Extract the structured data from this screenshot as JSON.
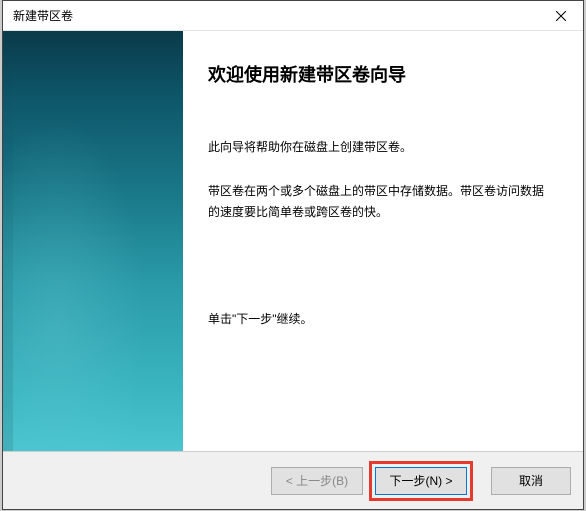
{
  "titlebar": {
    "title": "新建带区卷"
  },
  "main": {
    "heading": "欢迎使用新建带区卷向导",
    "para1": "此向导将帮助你在磁盘上创建带区卷。",
    "para2": "带区卷在两个或多个磁盘上的带区中存储数据。带区卷访问数据的速度要比简单卷或跨区卷的快。",
    "para3": "单击\"下一步\"继续。"
  },
  "footer": {
    "back": "< 上一步(B)",
    "next": "下一步(N) >",
    "cancel": "取消"
  }
}
